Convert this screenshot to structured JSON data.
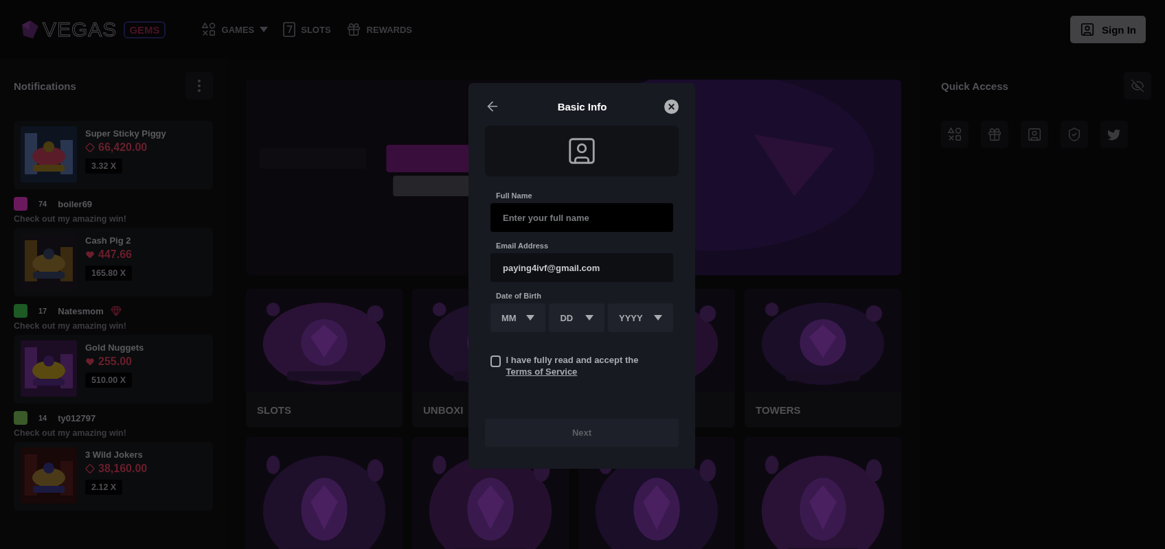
{
  "header": {
    "logo": {
      "word": "VEGAS",
      "badge": "GEMS"
    },
    "nav": [
      {
        "label": "GAMES",
        "dropdown": true
      },
      {
        "label": "SLOTS",
        "dropdown": false
      },
      {
        "label": "REWARDS",
        "dropdown": false
      }
    ],
    "sign_in": "Sign In"
  },
  "notifications": {
    "title": "Notifications",
    "items": [
      {
        "kind": "outline",
        "game": "Super Sticky Piggy",
        "amount": "66,420.00",
        "multiplier": "3.32 X"
      },
      {
        "kind": "filled",
        "user": {
          "name": "boiler69",
          "level": "74",
          "color": "#6a1a5c",
          "vip": false
        },
        "message": "Check out my amazing win!",
        "game": "Cash Pig 2",
        "amount": "447.66",
        "multiplier": "165.80 X"
      },
      {
        "kind": "filled",
        "user": {
          "name": "Natesmom",
          "level": "17",
          "color": "#1d5a24",
          "vip": true
        },
        "message": "Check out my amazing win!",
        "game": "Gold Nuggets",
        "amount": "255.00",
        "multiplier": "510.00 X"
      },
      {
        "kind": "outline",
        "user": {
          "name": "ty012797",
          "level": "14",
          "color": "#3a5a2a",
          "vip": false
        },
        "message": "Check out my amazing win!",
        "game": "3 Wild Jokers",
        "amount": "38,160.00",
        "multiplier": "2.12 X"
      }
    ]
  },
  "game_tiles": [
    {
      "kind": "labeled",
      "label": "SLOTS"
    },
    {
      "kind": "labeled",
      "label": "UNBOXI"
    },
    {
      "kind": "picture"
    },
    {
      "kind": "labeled",
      "label": "TOWERS"
    }
  ],
  "quick_access": {
    "title": "Quick Access"
  },
  "modal": {
    "title": "Basic Info",
    "fields": [
      {
        "label": "Full Name",
        "placeholder": "Enter your full name",
        "focused": true
      },
      {
        "label": "Email Address",
        "value": "paying4ivf@gmail.com",
        "focused": false
      }
    ],
    "dob": {
      "label": "Date of Birth",
      "selects": [
        {
          "placeholder": "MM"
        },
        {
          "placeholder": "DD"
        },
        {
          "placeholder": "YYYY"
        }
      ]
    },
    "terms": {
      "text": "I have fully read and accept the",
      "link": "Terms of Service",
      "checked": false
    },
    "next": {
      "label": "Next",
      "disabled": true
    }
  }
}
